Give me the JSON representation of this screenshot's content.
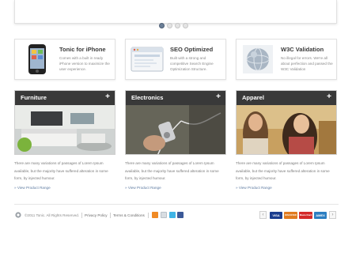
{
  "slider": {
    "pages": 4,
    "active_page": 1
  },
  "features": [
    {
      "title": "Tonic for iPhone",
      "text": "Comes with a built in ready iPhone version to maximize the user experience.",
      "icon": "iphone-icon"
    },
    {
      "title": "SEO Optimized",
      "text": "Built with a strong and competitive Search Engine Optimization Structure.",
      "icon": "browser-window-icon"
    },
    {
      "title": "W3C Validation",
      "text": "No illegal for errors. We're all about perfection and passed the W3C Validation",
      "icon": "globe-icon"
    }
  ],
  "categories": [
    {
      "title": "Furniture",
      "plus": "+",
      "desc": "There are many variations of passages of Lorem Ipsum available, but the majority have suffered alteration in some form, by injected humour.",
      "link": "» View Product Range"
    },
    {
      "title": "Electronics",
      "plus": "+",
      "desc": "There are many variations of passages of Lorem Ipsum available, but the majority have suffered alteration in some form, by injected humour.",
      "link": "» View Product Range"
    },
    {
      "title": "Apparel",
      "plus": "+",
      "desc": "There are many variations of passages of Lorem Ipsum available, but the majority have suffered alteration in some form, by injected humour.",
      "link": "» View Product Range"
    }
  ],
  "footer": {
    "copyright": "©2011 Tonic. All Rights Reserved.",
    "privacy": "Privacy Policy",
    "terms": "Terms & Conditions",
    "social_icons": [
      "rss-icon",
      "email-icon",
      "twitter-icon",
      "facebook-icon"
    ],
    "payment_cards": [
      {
        "name": "VISA",
        "color": "#1a3d8f"
      },
      {
        "name": "DISCOVER",
        "color": "#e07b1f"
      },
      {
        "name": "MasterCard",
        "color": "#d42a2a"
      },
      {
        "name": "AMEX",
        "color": "#2c7ec1"
      }
    ],
    "prev": "‹",
    "next": "›"
  },
  "colors": {
    "link": "#5d7aa0",
    "category_bar": "#282828",
    "active_dot": "#6b7f97"
  }
}
